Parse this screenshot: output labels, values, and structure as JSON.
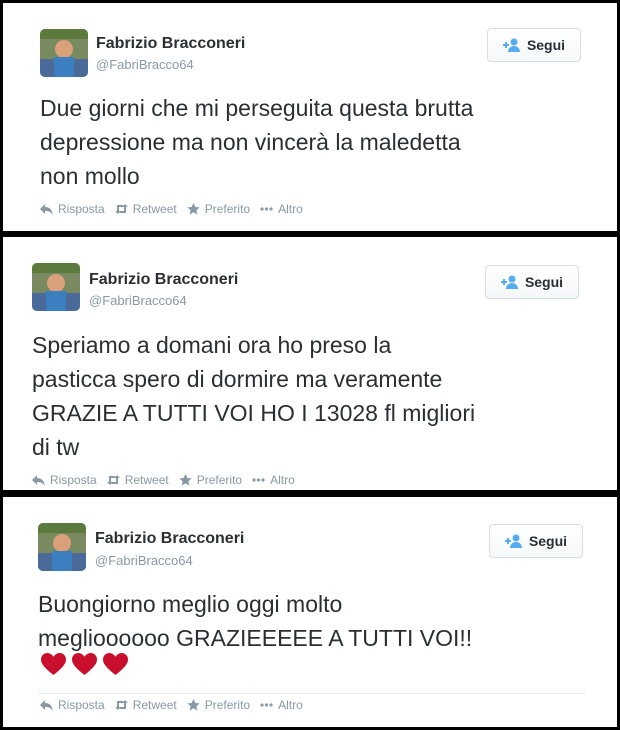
{
  "tweets": [
    {
      "name": "Fabrizio Bracconeri",
      "handle": "@FabriBracco64",
      "follow_label": "Segui",
      "text": "Due giorni che mi perseguita questa brutta\ndepressione ma non vincerà la maledetta\nnon mollo",
      "hearts": 0,
      "actions": {
        "reply": "Risposta",
        "retweet": "Retweet",
        "favorite": "Preferito",
        "more": "Altro"
      }
    },
    {
      "name": "Fabrizio Bracconeri",
      "handle": "@FabriBracco64",
      "follow_label": "Segui",
      "text": "Speriamo a domani ora ho preso la\npasticca spero di dormire ma veramente\nGRAZIE A TUTTI VOI HO I 13028 fl migliori\ndi tw",
      "hearts": 0,
      "actions": {
        "reply": "Risposta",
        "retweet": "Retweet",
        "favorite": "Preferito",
        "more": "Altro"
      }
    },
    {
      "name": "Fabrizio Bracconeri",
      "handle": "@FabriBracco64",
      "follow_label": "Segui",
      "text": "Buongiorno meglio oggi molto\nmeglioooooo GRAZIEEEEE A TUTTI VOI!!",
      "hearts": 3,
      "actions": {
        "reply": "Risposta",
        "retweet": "Retweet",
        "favorite": "Preferito",
        "more": "Altro"
      }
    }
  ],
  "colors": {
    "heart": "#c8102e",
    "icon": "#8899a6",
    "follow_icon": "#55acee"
  }
}
